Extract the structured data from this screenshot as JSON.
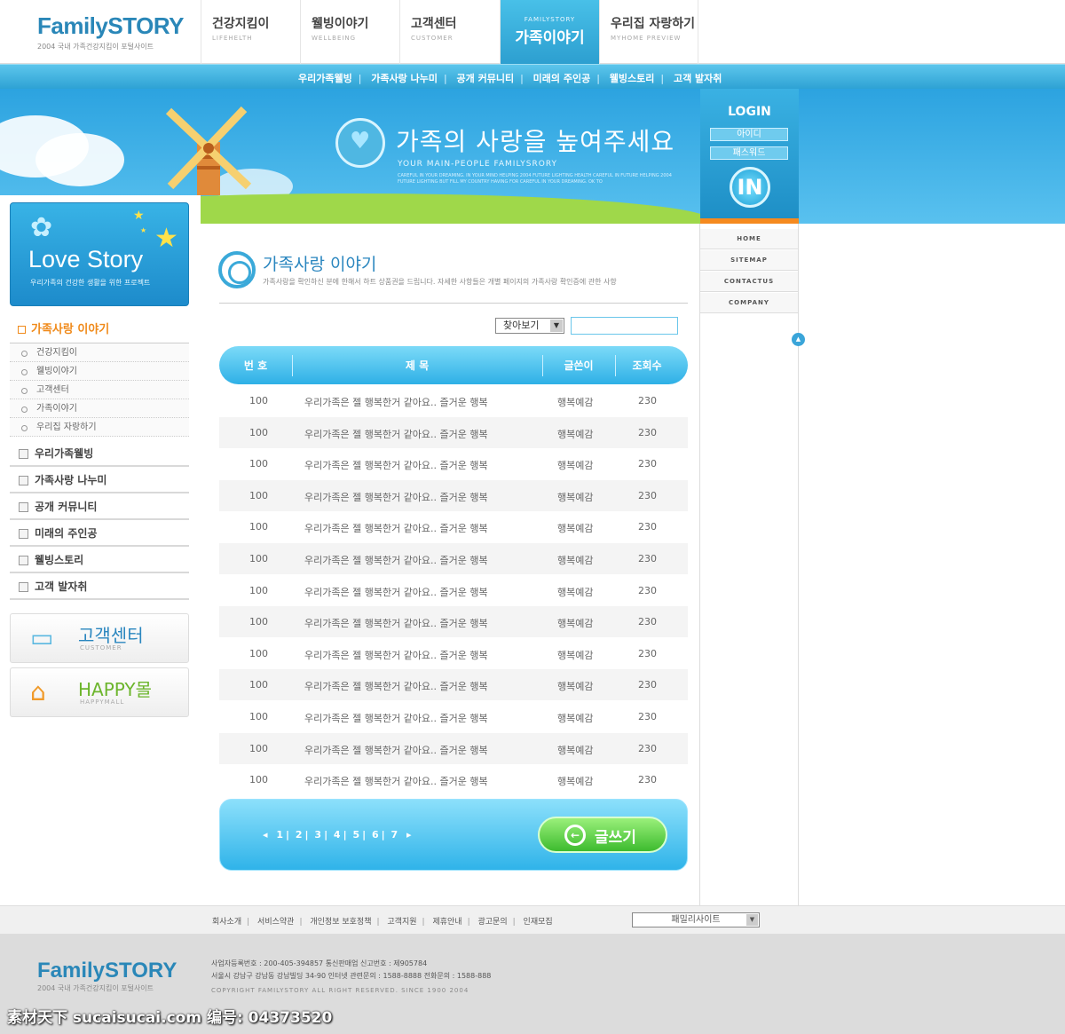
{
  "header": {
    "logo_text": "FamilySTORY",
    "logo_sub": "2004 국내 가족건강지킴이 포털사이트",
    "nav": [
      {
        "ko": "건강지킴이",
        "en": "LIFEHELTH"
      },
      {
        "ko": "웰빙이야기",
        "en": "WELLBEING"
      },
      {
        "ko": "고객센터",
        "en": "CUSTOMER"
      },
      {
        "ko": "가족이야기",
        "en": "FAMILYSTORY"
      },
      {
        "ko": "우리집 자랑하기",
        "en": "MYHOME PREVIEW"
      }
    ]
  },
  "subnav": [
    "우리가족웰빙",
    "가족사랑 나누미",
    "공개 커뮤니티",
    "미래의 주인공",
    "웰빙스토리",
    "고객 발자취"
  ],
  "banner": {
    "title": "가족의 사랑을 높여주세요",
    "subtitle": "YOUR MAIN-PEOPLE FAMILYSRORY",
    "tiny": "CAREFUL IN YOUR DREAMING. IN YOUR MIND HELPING 2004 FUTURE LIGHTING HEALTH CAREFUL IN FUTURE HELPING 2004 FUTURE LIGHTING BUT FILL MY COUNTRY HAVING FOR CAREFUL IN YOUR DREAMING. OK TO"
  },
  "login": {
    "title": "LOGIN",
    "id_label": "아이디",
    "pw_label": "패스워드",
    "button": "IN"
  },
  "sidebar": {
    "promo_title": "Love Story",
    "promo_sub": "우리가족의 건강한 생활을 위한 프로젝트",
    "section_title": "가족사랑 이야기",
    "sub_items": [
      "건강지킴이",
      "웰빙이야기",
      "고객센터",
      "가족이야기",
      "우리집 자랑하기"
    ],
    "main_items": [
      "우리가족웰빙",
      "가족사랑 나누미",
      "공개 커뮤니티",
      "미래의 주인공",
      "웰빙스토리",
      "고객 발자취"
    ],
    "banner1": {
      "title": "고객센터",
      "en": "CUSTOMER"
    },
    "banner2": {
      "title": "HAPPY몰",
      "en": "HAPPYMALL"
    }
  },
  "content": {
    "title": "가족사랑 이야기",
    "desc": "가족사랑을 확인하신 분에 한해서 하트 상품권을 드립니다. 자세한 사항들은 개별 페이지의 가족사랑 확인증에 관한 사항",
    "search_select": "찾아보기",
    "columns": [
      "번 호",
      "제 목",
      "글쓴이",
      "조회수"
    ],
    "rows": [
      {
        "no": "100",
        "title": "우리가족은 젤 행복한거 같아요.. 즐거운 행복",
        "author": "행복예감",
        "views": "230"
      },
      {
        "no": "100",
        "title": "우리가족은 젤 행복한거 같아요.. 즐거운 행복",
        "author": "행복예감",
        "views": "230"
      },
      {
        "no": "100",
        "title": "우리가족은 젤 행복한거 같아요.. 즐거운 행복",
        "author": "행복예감",
        "views": "230"
      },
      {
        "no": "100",
        "title": "우리가족은 젤 행복한거 같아요.. 즐거운 행복",
        "author": "행복예감",
        "views": "230"
      },
      {
        "no": "100",
        "title": "우리가족은 젤 행복한거 같아요.. 즐거운 행복",
        "author": "행복예감",
        "views": "230"
      },
      {
        "no": "100",
        "title": "우리가족은 젤 행복한거 같아요.. 즐거운 행복",
        "author": "행복예감",
        "views": "230"
      },
      {
        "no": "100",
        "title": "우리가족은 젤 행복한거 같아요.. 즐거운 행복",
        "author": "행복예감",
        "views": "230"
      },
      {
        "no": "100",
        "title": "우리가족은 젤 행복한거 같아요.. 즐거운 행복",
        "author": "행복예감",
        "views": "230"
      },
      {
        "no": "100",
        "title": "우리가족은 젤 행복한거 같아요.. 즐거운 행복",
        "author": "행복예감",
        "views": "230"
      },
      {
        "no": "100",
        "title": "우리가족은 젤 행복한거 같아요.. 즐거운 행복",
        "author": "행복예감",
        "views": "230"
      },
      {
        "no": "100",
        "title": "우리가족은 젤 행복한거 같아요.. 즐거운 행복",
        "author": "행복예감",
        "views": "230"
      },
      {
        "no": "100",
        "title": "우리가족은 젤 행복한거 같아요.. 즐거운 행복",
        "author": "행복예감",
        "views": "230"
      },
      {
        "no": "100",
        "title": "우리가족은 젤 행복한거 같아요.. 즐거운 행복",
        "author": "행복예감",
        "views": "230"
      }
    ],
    "pages": [
      "1",
      "2",
      "3",
      "4",
      "5",
      "6",
      "7"
    ],
    "write_button": "글쓰기"
  },
  "right_links": [
    "HOME",
    "SITEMAP",
    "CONTACTUS",
    "COMPANY"
  ],
  "footer": {
    "links": [
      "회사소개",
      "서비스약관",
      "개인정보 보호정책",
      "고객지원",
      "제휴안내",
      "광고문의",
      "인재모집"
    ],
    "family_site": "패밀리사이트",
    "info_line1": "사업자등록번호 : 200-405-394857   통신판매업 신고번호 : 제905784",
    "info_line2": "서울시 강남구 강남동 강남빌딩 34-90   인터넷 관련문의 : 1588-8888 전화문의 : 1588-888",
    "copyright": "COPYRIGHT FAMILYSTORY ALL RIGHT RESERVED. SINCE 1900 2004"
  },
  "watermark": "素材天下 sucaisucai.com  编号: 04373520",
  "colors": {
    "accent": "#2eb0e6",
    "orange": "#f08a1a",
    "green": "#3dbb2f"
  }
}
